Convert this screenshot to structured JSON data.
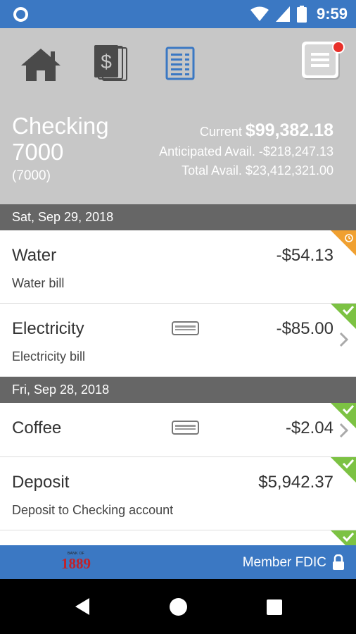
{
  "status_bar": {
    "time": "9:59"
  },
  "header": {
    "nav": [
      "home-icon",
      "statements-icon",
      "transactions-icon",
      "menu-icon"
    ],
    "account_name": "Checking 7000",
    "account_number": "(7000)",
    "current_label": "Current",
    "current_value": "$99,382.18",
    "anticipated": "Anticipated Avail. -$218,247.13",
    "total": "Total Avail. $23,412,321.00"
  },
  "groups": [
    {
      "date": "Sat, Sep 29, 2018",
      "items": [
        {
          "title": "Water",
          "description": "Water bill",
          "amount": "-$54.13",
          "status": "pending"
        },
        {
          "title": "Electricity",
          "description": "Electricity bill",
          "amount": "-$85.00",
          "status": "cleared"
        }
      ]
    },
    {
      "date": "Fri, Sep 28, 2018",
      "items": [
        {
          "title": "Coffee",
          "description": "",
          "amount": "-$2.04",
          "status": "cleared"
        },
        {
          "title": "Deposit",
          "description": "Deposit to Checking account",
          "amount": "$5,942.37",
          "status": "cleared"
        }
      ]
    }
  ],
  "footer": {
    "logo_small": "BANK OF",
    "logo_big": "1889",
    "fdic": "Member FDIC"
  },
  "colors": {
    "primary": "#3b78c3",
    "header_bg": "#c7c7c7",
    "date_bar": "#666666",
    "cleared": "#7cc243",
    "pending": "#f0a030",
    "notification": "#e8302a"
  }
}
